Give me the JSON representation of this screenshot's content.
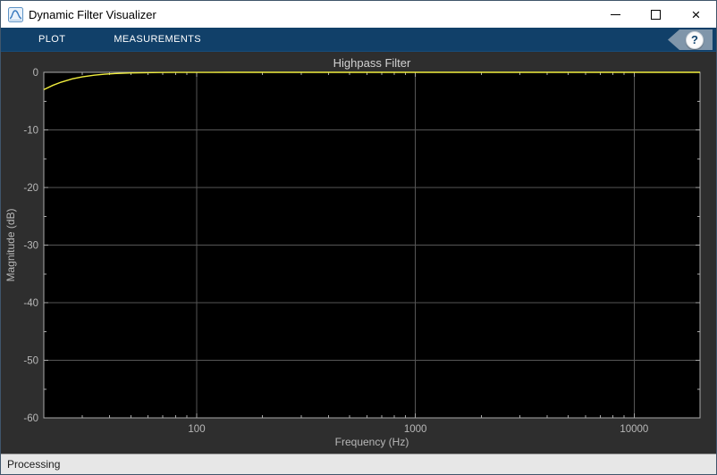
{
  "window": {
    "title": "Dynamic Filter Visualizer",
    "controls": {
      "minimize": "minimize-window",
      "maximize": "maximize-window",
      "close": "close-window",
      "close_glyph": "×"
    }
  },
  "toolstrip": {
    "tabs": [
      {
        "label": "PLOT"
      },
      {
        "label": "MEASUREMENTS"
      }
    ],
    "help_glyph": "?"
  },
  "statusbar": {
    "text": "Processing"
  },
  "colors": {
    "toolstrip_bg": "#114069",
    "figure_bg": "#2e2e2e",
    "plot_bg": "#000000",
    "axis_color": "#a9a9a9",
    "grid_color": "#565656",
    "tick_label_color": "#b8b8b8",
    "title_color": "#d2d2d2",
    "line_color": "#f1ee3e",
    "status_bg": "#e7e7e7"
  },
  "chart_data": {
    "type": "line",
    "title": "Highpass Filter",
    "xlabel": "Frequency (Hz)",
    "ylabel": "Magnitude (dB)",
    "xscale": "log",
    "xlim": [
      20,
      20000
    ],
    "ylim": [
      -60,
      0
    ],
    "x_major_ticks": [
      100,
      1000,
      10000
    ],
    "x_major_tick_labels": [
      "100",
      "1000",
      "10000"
    ],
    "y_major_ticks": [
      0,
      -10,
      -20,
      -30,
      -40,
      -50,
      -60
    ],
    "y_major_tick_labels": [
      "0",
      "-10",
      "-20",
      "-30",
      "-40",
      "-50",
      "-60"
    ],
    "y_minor_ticks": [
      -5,
      -15,
      -25,
      -35,
      -45,
      -55
    ],
    "grid": true,
    "legend": "none",
    "series": [
      {
        "name": "Highpass Filter",
        "x": [
          20,
          22,
          24,
          27,
          30,
          34,
          38,
          43,
          50,
          58,
          68,
          80,
          95,
          115,
          140,
          170,
          210,
          260,
          330,
          420,
          550,
          720,
          1000,
          1500,
          2200,
          3300,
          5000,
          7500,
          11000,
          15000,
          20000
        ],
        "y": [
          -3.01,
          -2.26,
          -1.71,
          -1.14,
          -0.78,
          -0.49,
          -0.32,
          -0.2,
          -0.11,
          -0.06,
          -0.03,
          -0.017,
          -0.009,
          -0.004,
          -0.002,
          -0.001,
          0,
          0,
          0,
          0,
          0,
          0,
          0,
          0,
          0,
          0,
          0,
          0,
          0,
          0,
          0
        ]
      }
    ]
  }
}
